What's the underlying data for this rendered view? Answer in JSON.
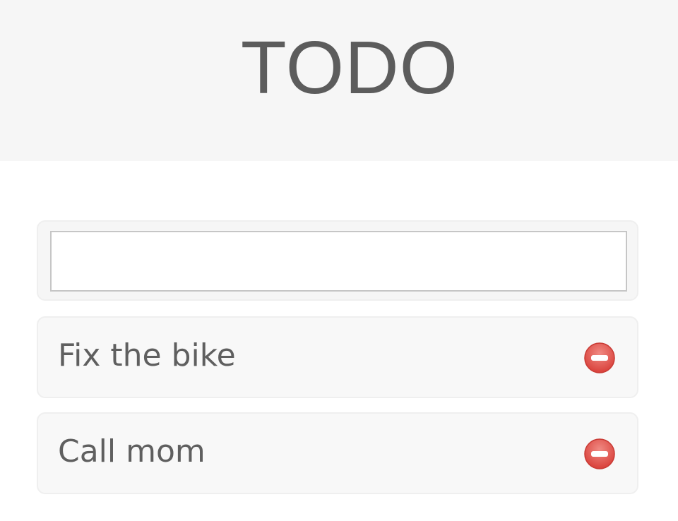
{
  "header": {
    "title": "TODO"
  },
  "new_todo": {
    "value": "",
    "placeholder": ""
  },
  "todos": [
    {
      "label": "Fix the bike",
      "icon": "remove-icon"
    },
    {
      "label": "Call mom",
      "icon": "remove-icon"
    }
  ],
  "colors": {
    "header_background": "#f6f6f6",
    "title_text": "#5c5c5c",
    "item_text": "#5f5f5f",
    "remove_icon": "#e0514a"
  }
}
